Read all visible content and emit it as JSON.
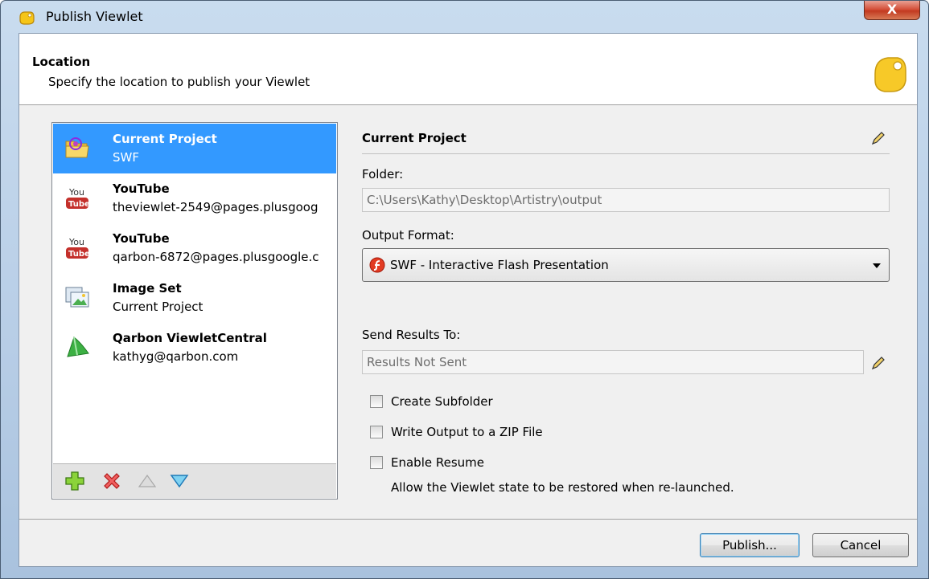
{
  "window": {
    "title": "Publish Viewlet",
    "close_label": "X"
  },
  "header": {
    "title": "Location",
    "subtitle": "Specify the location to publish your Viewlet"
  },
  "locations": [
    {
      "name": "Current Project",
      "detail": "SWF",
      "icon": "folder-flash-icon",
      "selected": true
    },
    {
      "name": "YouTube",
      "detail": "theviewlet-2549@pages.plusgoog",
      "icon": "youtube-icon",
      "selected": false
    },
    {
      "name": "YouTube",
      "detail": "qarbon-6872@pages.plusgoogle.c",
      "icon": "youtube-icon",
      "selected": false
    },
    {
      "name": "Image Set",
      "detail": "Current Project",
      "icon": "image-set-icon",
      "selected": false
    },
    {
      "name": "Qarbon ViewletCentral",
      "detail": "kathyg@qarbon.com",
      "icon": "viewletcentral-icon",
      "selected": false
    }
  ],
  "list_toolbar": {
    "add": "add-icon",
    "remove": "remove-icon",
    "up": "move-up-icon",
    "down": "move-down-icon"
  },
  "details": {
    "title": "Current Project",
    "folder_label": "Folder:",
    "folder_value": "C:\\Users\\Kathy\\Desktop\\Artistry\\output",
    "format_label": "Output Format:",
    "format_value": "SWF - Interactive Flash Presentation",
    "send_label": "Send Results To:",
    "send_value": "Results Not Sent",
    "checkboxes": [
      {
        "label": "Create Subfolder",
        "checked": false
      },
      {
        "label": "Write Output to a ZIP File",
        "checked": false
      },
      {
        "label": "Enable Resume",
        "checked": false
      }
    ],
    "resume_note": "Allow the Viewlet state to be restored when re-launched."
  },
  "buttons": {
    "publish": "Publish...",
    "cancel": "Cancel"
  },
  "colors": {
    "selection": "#3399ff",
    "accent_title_close": "#c23a20"
  }
}
